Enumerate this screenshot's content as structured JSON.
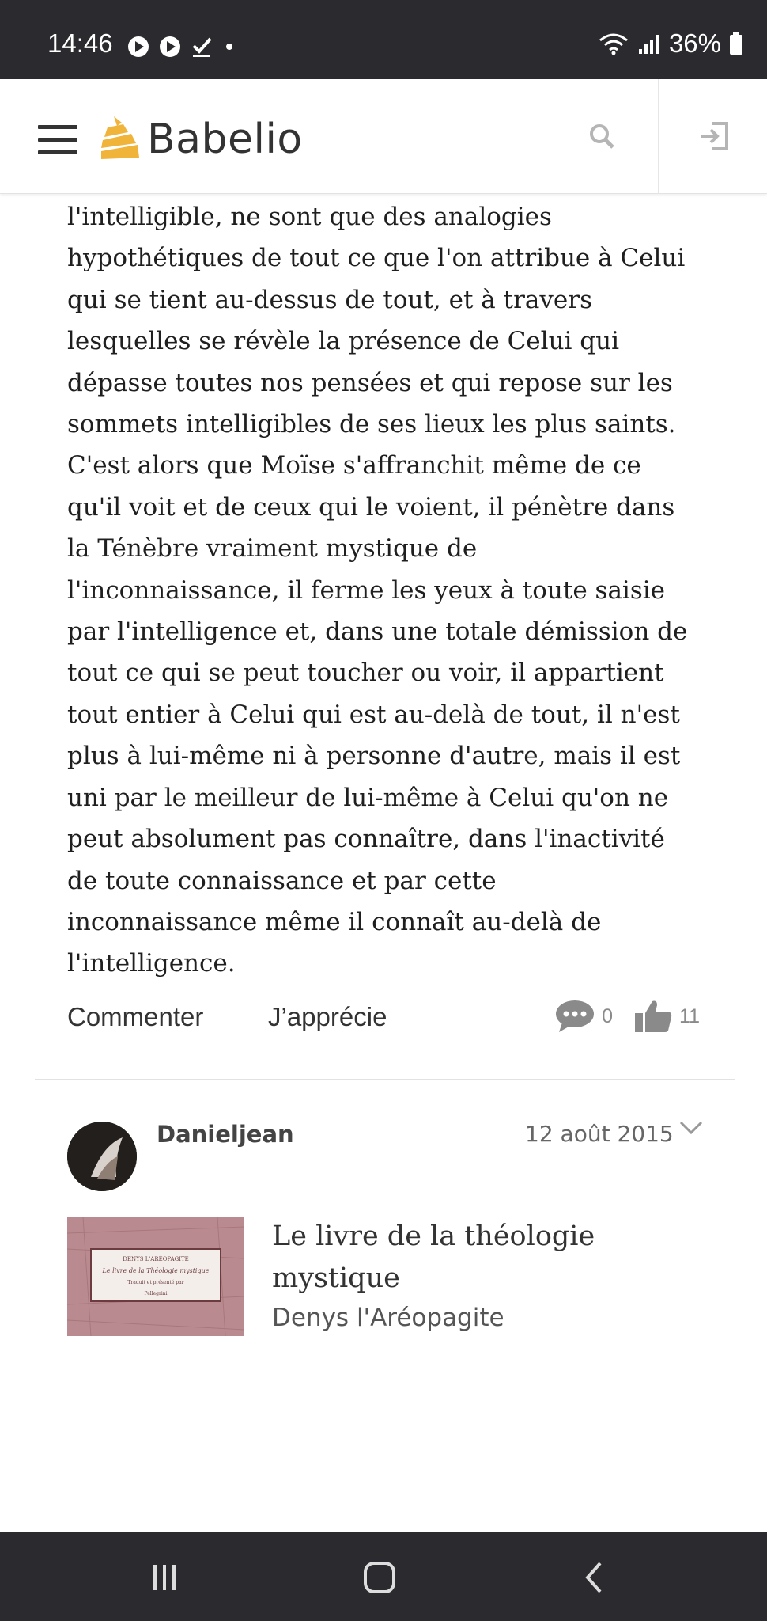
{
  "status_bar": {
    "time": "14:46",
    "battery": "36%",
    "icons": [
      "play-badge-icon",
      "play-badge-icon",
      "check-download-icon",
      "dot-icon",
      "wifi-icon",
      "signal-icon",
      "battery-icon"
    ]
  },
  "header": {
    "logo_text": "Babelio",
    "brand_color": "#f0b43a",
    "search_icon": "search-icon",
    "login_icon": "login-icon"
  },
  "review": {
    "lines": [
      "l'intelligible, ne sont que des analogies",
      "hypothétiques de tout ce que l'on attribue à Celui",
      "qui se tient au-dessus de tout, et à travers",
      "lesquelles se révèle la présence de Celui qui",
      "dépasse toutes nos pensées et qui repose sur les",
      "sommets intelligibles de ses lieux les plus saints.",
      "C'est alors que Moïse s'affranchit même de ce",
      "qu'il voit et de ceux qui le voient, il pénètre dans",
      "la Ténèbre vraiment mystique de",
      "l'inconnaissance, il ferme les yeux à toute saisie",
      "par l'intelligence et, dans une totale démission de",
      "tout ce qui se peut toucher ou voir, il appartient",
      "tout entier à Celui qui est au-delà de tout, il n'est",
      "plus à lui-même ni à personne d'autre, mais il est",
      "uni par le meilleur de lui-même à Celui qu'on ne",
      "peut absolument pas connaître, dans l'inactivité",
      "de toute connaissance et par cette",
      "inconnaissance même il connaît au-delà de",
      "l'intelligence."
    ],
    "actions": {
      "comment_label": "Commenter",
      "like_label": "J’apprécie",
      "comment_count": "0",
      "like_count": "11"
    }
  },
  "next_review": {
    "username": "Danieljean",
    "date": "12 août 2015",
    "book_title": "Le livre de la théologie mystique",
    "book_author": "Denys l'Aréopagite",
    "cover_lines": [
      "DENYS L'ARÉOPAGITE",
      "Le livre de la Théologie mystique",
      "Traduit et présenté par",
      "Pellegrini"
    ]
  }
}
